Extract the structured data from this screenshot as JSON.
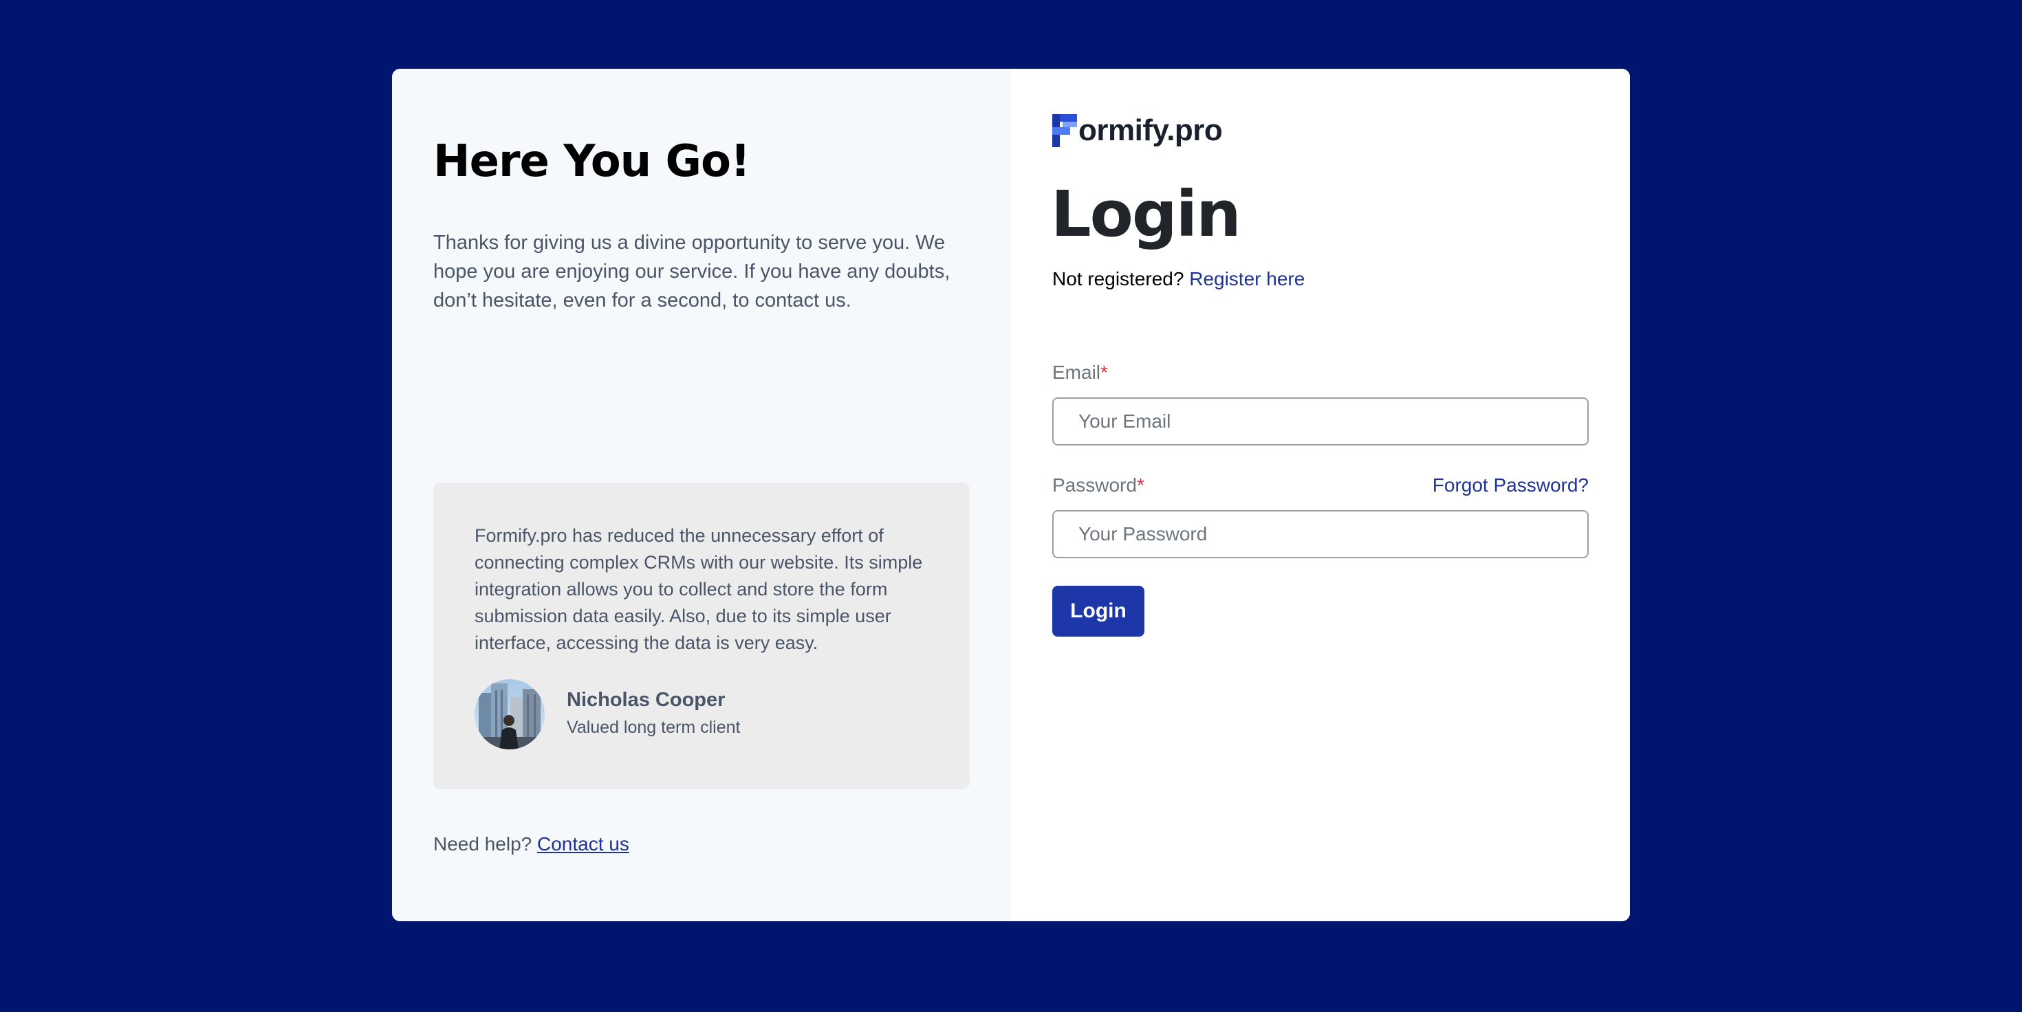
{
  "hero": {
    "title": "Here You Go!",
    "description": "Thanks for giving us a divine opportunity to serve you. We hope you are enjoying our service. If you have any doubts, don’t hesitate, even for a second, to contact us."
  },
  "testimonial": {
    "quote": "Formify.pro has reduced the unnecessary effort of connecting complex CRMs with our website. Its simple integration allows you to collect and store the form submission data easily. Also, due to its simple user interface, accessing the data is very easy.",
    "author_name": "Nicholas Cooper",
    "author_role": "Valued long term client"
  },
  "help": {
    "prefix": "Need help?",
    "link": "Contact us"
  },
  "brand": {
    "logo_text": "ormify.pro",
    "accent": "#1e37a8",
    "background": "#00166e"
  },
  "login": {
    "title": "Login",
    "register_prefix": "Not registered?",
    "register_link": "Register here",
    "email_label": "Email",
    "email_placeholder": "Your Email",
    "password_label": "Password",
    "password_placeholder": "Your Password",
    "required_mark": "*",
    "forgot_link": "Forgot Password?",
    "submit_label": "Login"
  }
}
